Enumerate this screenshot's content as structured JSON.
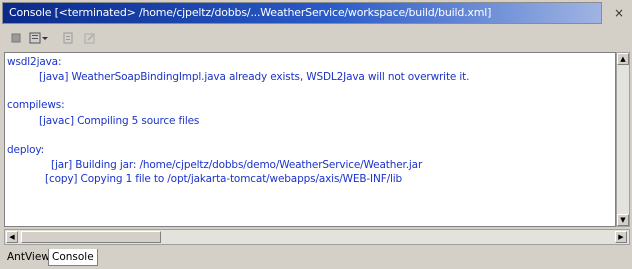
{
  "window": {
    "title": "Console [<terminated> /home/cjpeltz/dobbs/...WeatherService/workspace/build/build.xml]",
    "close_glyph": "×"
  },
  "toolbar": {
    "icons": [
      "terminate-icon",
      "pin-console-icon",
      "dropdown-icon",
      "clear-console-icon",
      "scroll-lock-icon"
    ]
  },
  "console": {
    "lines": [
      "wsdl2java:",
      "[java] WeatherSoapBindingImpl.java already exists, WSDL2Java will not overwrite it.",
      "compilews:",
      "[javac] Compiling 5 source files",
      "deploy:",
      "[jar] Building jar: /home/cjpeltz/dobbs/demo/WeatherService/Weather.jar",
      "[copy] Copying 1 file to /opt/jakarta-tomcat/webapps/axis/WEB-INF/lib"
    ],
    "text_color": "#1b33c9"
  },
  "tabs": [
    {
      "label": "AntView",
      "active": false
    },
    {
      "label": "Console",
      "active": true
    }
  ]
}
